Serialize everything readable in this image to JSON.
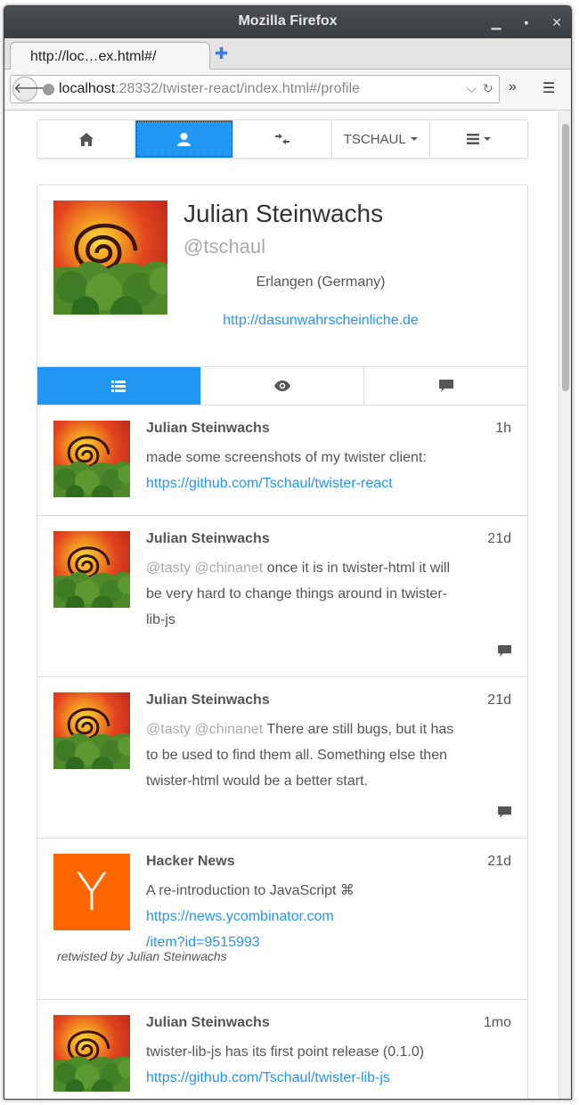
{
  "window": {
    "title": "Mozilla Firefox"
  },
  "tab": {
    "label": "http://loc…ex.html#/"
  },
  "urlbar": {
    "host": "localhost",
    "rest": ":28332/twister-react/index.html#/profile"
  },
  "appnav": {
    "user_menu_label": "TSCHAUL"
  },
  "profile": {
    "name": "Julian Steinwachs",
    "handle": "@tschaul",
    "location": "Erlangen (Germany)",
    "url": "http://dasunwahrscheinliche.de"
  },
  "posts": [
    {
      "author": "Julian Steinwachs",
      "time": "1h",
      "text": "made some screenshots of my twister client: ",
      "link": "https://github.com/Tschaul/twister-react"
    },
    {
      "author": "Julian Steinwachs",
      "time": "21d",
      "mention1": "@tasty",
      "mention2": "@chinanet",
      "text": " once it is in twister-html it will be very hard to change things around in twister-lib-js"
    },
    {
      "author": "Julian Steinwachs",
      "time": "21d",
      "mention1": "@tasty",
      "mention2": "@chinanet",
      "text": " There are still bugs, but it has to be used to find them all. Something else then twister-html would be a better start."
    },
    {
      "author": "Hacker News",
      "avatar_letter": "Y",
      "time": "21d",
      "text": "A re-introduction to JavaScript ⌘",
      "link1": "https://news.ycombinator.com",
      "link2": "/item?id=9515993",
      "retwisted": "retwisted by Julian Steinwachs"
    },
    {
      "author": "Julian Steinwachs",
      "time": "1mo",
      "text": "twister-lib-js has its first point release (0.1.0)",
      "link": "https://github.com/Tschaul/twister-lib-js"
    }
  ],
  "colors": {
    "accent": "#2196f3",
    "hn_orange": "#ff6600"
  }
}
